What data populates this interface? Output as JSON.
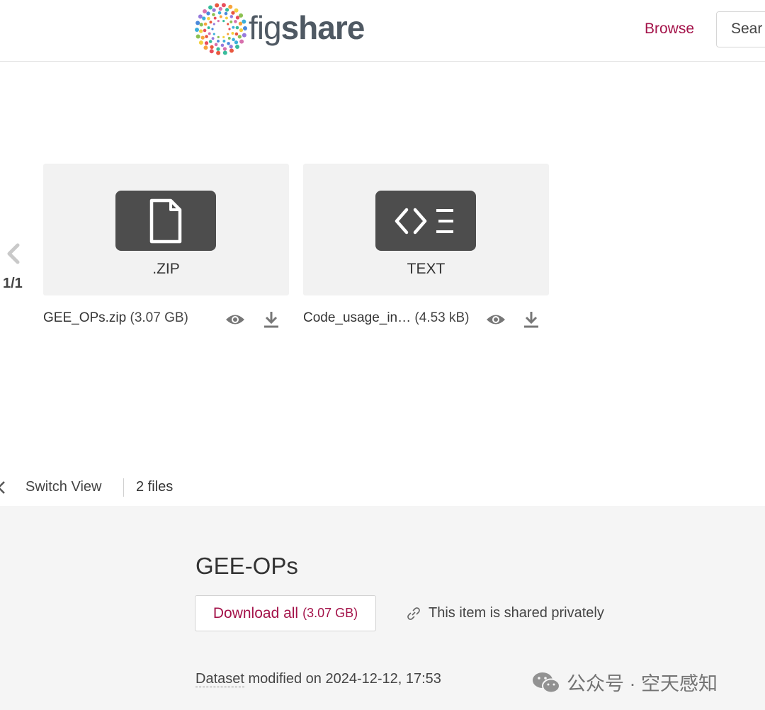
{
  "header": {
    "logo": {
      "text_fig": "fig",
      "text_share": "share"
    },
    "nav": {
      "browse_label": "Browse"
    },
    "search": {
      "placeholder": "Sear"
    }
  },
  "viewer": {
    "page_indicator": "1/1",
    "files": [
      {
        "type_label": ".ZIP",
        "name": "GEE_OPs.zip",
        "size": "(3.07 GB)",
        "icon": "file-icon"
      },
      {
        "type_label": "TEXT",
        "name": "Code_usage_in…",
        "size": "(4.53 kB)",
        "icon": "code-file-icon"
      }
    ]
  },
  "toolbar": {
    "switch_view_label": "Switch View",
    "file_count": "2 files"
  },
  "dataset": {
    "title": "GEE-OPs",
    "download_label": "Download all",
    "download_size": "(3.07 GB)",
    "shared_note": "This item is shared privately",
    "modified_prefix": "Dataset",
    "modified_text": " modified on 2024-12-12, 17:53"
  },
  "watermark": {
    "text": "公众号 · 空天感知"
  },
  "colors": {
    "accent": "#a4134a",
    "card_bg": "#f2f2f2",
    "icon_box": "#4d4d4d",
    "details_bg": "#f5f5f5"
  }
}
